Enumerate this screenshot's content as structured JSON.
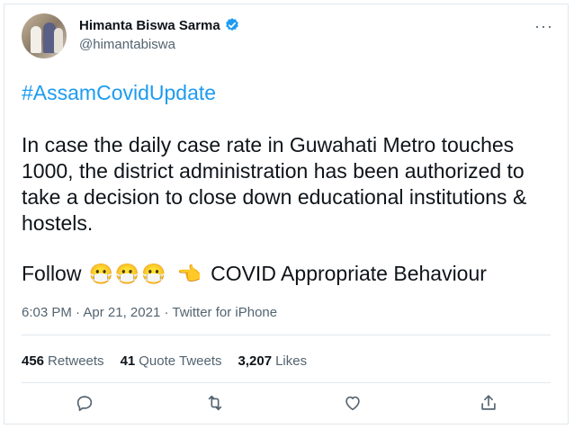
{
  "author": {
    "name": "Himanta Biswa Sarma",
    "handle": "@himantabiswa",
    "verified_color": "#1d9bf0"
  },
  "tweet": {
    "hashtag": "#AssamCovidUpdate",
    "body": "In case the daily case rate in Guwahati Metro touches 1000, the district administration has been authorized to take a decision to close down educational institutions & hostels.",
    "follow_prefix": "Follow",
    "mask_emoji": "😷",
    "point_emoji": "👈",
    "follow_suffix": "COVID Appropriate Behaviour"
  },
  "meta": {
    "time": "6:03 PM",
    "separator": "·",
    "date": "Apr 21, 2021",
    "source": "Twitter for iPhone"
  },
  "stats": {
    "retweets_count": "456",
    "retweets_label": "Retweets",
    "quote_count": "41",
    "quote_label": "Quote Tweets",
    "likes_count": "3,207",
    "likes_label": "Likes"
  },
  "icons": {
    "more": "more-icon",
    "reply": "reply-icon",
    "retweet": "retweet-icon",
    "like": "like-icon",
    "share": "share-icon"
  },
  "colors": {
    "accent": "#1d9bf0",
    "text": "#0f1419",
    "secondary": "#536471",
    "border": "#e1e8ed"
  }
}
